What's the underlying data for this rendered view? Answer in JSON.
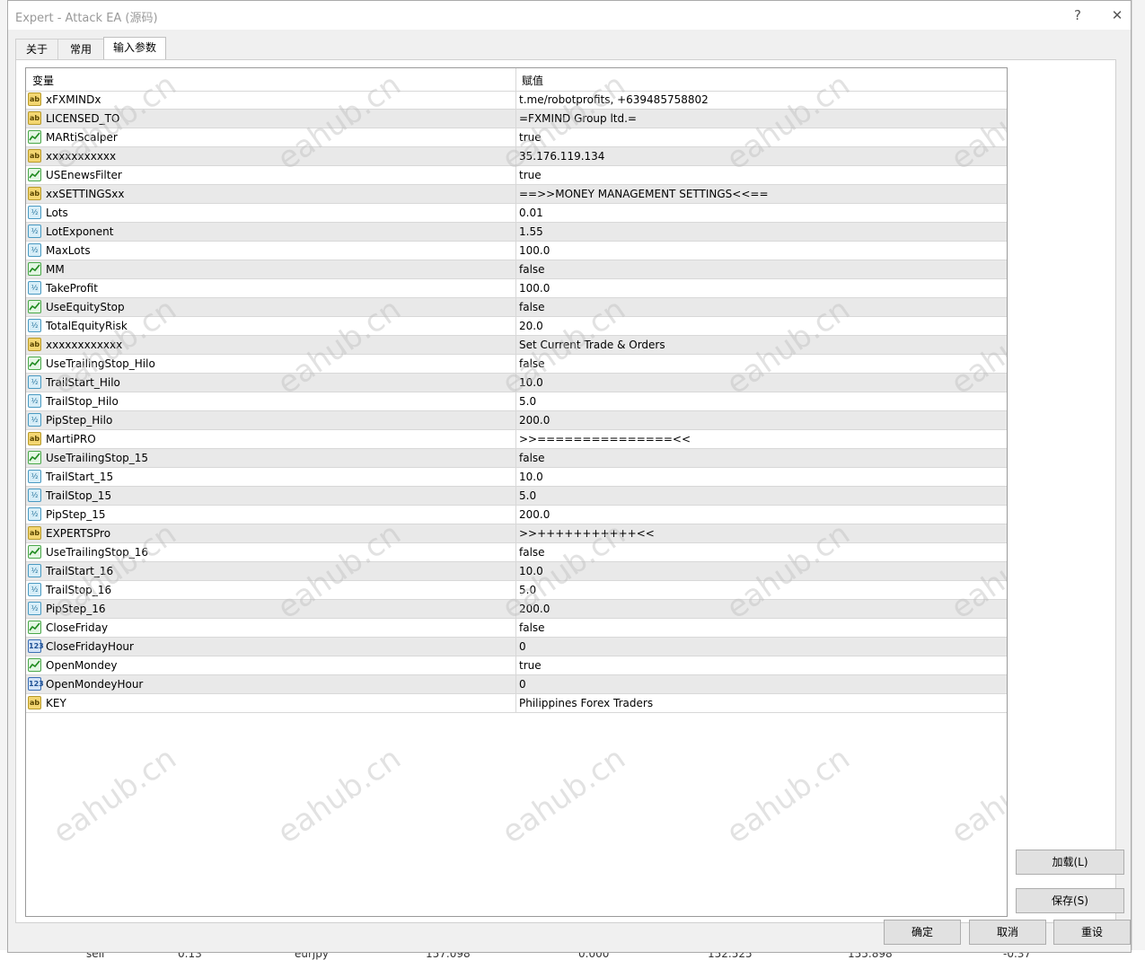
{
  "window": {
    "title": "Expert - Attack EA (源码)",
    "help_label": "?",
    "close_label": "✕"
  },
  "tabs": [
    {
      "label": "关于"
    },
    {
      "label": "常用"
    },
    {
      "label": "输入参数"
    }
  ],
  "table": {
    "columns": [
      "变量",
      "赋值"
    ],
    "rows": [
      {
        "type": "ab",
        "name": "xFXMINDx",
        "value": "t.me/robotprofits, +639485758802"
      },
      {
        "type": "ab",
        "name": "LICENSED_TO",
        "value": "=FXMIND Group ltd.="
      },
      {
        "type": "bool",
        "name": "MARtiScalper",
        "value": "true"
      },
      {
        "type": "ab",
        "name": "xxxxxxxxxxx",
        "value": "35.176.119.134"
      },
      {
        "type": "bool",
        "name": "USEnewsFilter",
        "value": "true"
      },
      {
        "type": "ab",
        "name": "xxSETTINGSxx",
        "value": "==>>MONEY MANAGEMENT SETTINGS<<=="
      },
      {
        "type": "dbl",
        "name": "Lots",
        "value": "0.01"
      },
      {
        "type": "dbl",
        "name": "LotExponent",
        "value": "1.55"
      },
      {
        "type": "dbl",
        "name": "MaxLots",
        "value": "100.0"
      },
      {
        "type": "bool",
        "name": "MM",
        "value": "false"
      },
      {
        "type": "dbl",
        "name": "TakeProfit",
        "value": "100.0"
      },
      {
        "type": "bool",
        "name": "UseEquityStop",
        "value": "false"
      },
      {
        "type": "dbl",
        "name": "TotalEquityRisk",
        "value": "20.0"
      },
      {
        "type": "ab",
        "name": "xxxxxxxxxxxx",
        "value": "Set Current Trade & Orders"
      },
      {
        "type": "bool",
        "name": "UseTrailingStop_Hilo",
        "value": "false"
      },
      {
        "type": "dbl",
        "name": "TrailStart_Hilo",
        "value": "10.0"
      },
      {
        "type": "dbl",
        "name": "TrailStop_Hilo",
        "value": "5.0"
      },
      {
        "type": "dbl",
        "name": "PipStep_Hilo",
        "value": "200.0"
      },
      {
        "type": "ab",
        "name": "MartiPRO",
        "value": ">>===============<<"
      },
      {
        "type": "bool",
        "name": "UseTrailingStop_15",
        "value": "false"
      },
      {
        "type": "dbl",
        "name": "TrailStart_15",
        "value": "10.0"
      },
      {
        "type": "dbl",
        "name": "TrailStop_15",
        "value": "5.0"
      },
      {
        "type": "dbl",
        "name": "PipStep_15",
        "value": "200.0"
      },
      {
        "type": "ab",
        "name": "EXPERTSPro",
        "value": ">>+++++++++++<<"
      },
      {
        "type": "bool",
        "name": "UseTrailingStop_16",
        "value": "false"
      },
      {
        "type": "dbl",
        "name": "TrailStart_16",
        "value": "10.0"
      },
      {
        "type": "dbl",
        "name": "TrailStop_16",
        "value": "5.0"
      },
      {
        "type": "dbl",
        "name": "PipStep_16",
        "value": "200.0"
      },
      {
        "type": "bool",
        "name": "CloseFriday",
        "value": "false"
      },
      {
        "type": "int",
        "name": "CloseFridayHour",
        "value": "0"
      },
      {
        "type": "bool",
        "name": "OpenMondey",
        "value": "true"
      },
      {
        "type": "int",
        "name": "OpenMondeyHour",
        "value": "0"
      },
      {
        "type": "ab",
        "name": "KEY",
        "value": "Philippines Forex Traders"
      }
    ]
  },
  "icons": {
    "ab": "ab",
    "dbl": "½",
    "int": "123"
  },
  "buttons": {
    "load": "加载(L)",
    "save": "保存(S)",
    "ok": "确定",
    "cancel": "取消",
    "reset": "重设"
  },
  "watermark": "eahub.cn",
  "background_row": [
    "sell",
    "0.13",
    "eurjpy",
    "157.098",
    "0.000",
    "152.525",
    "155.898",
    "-0.37"
  ]
}
